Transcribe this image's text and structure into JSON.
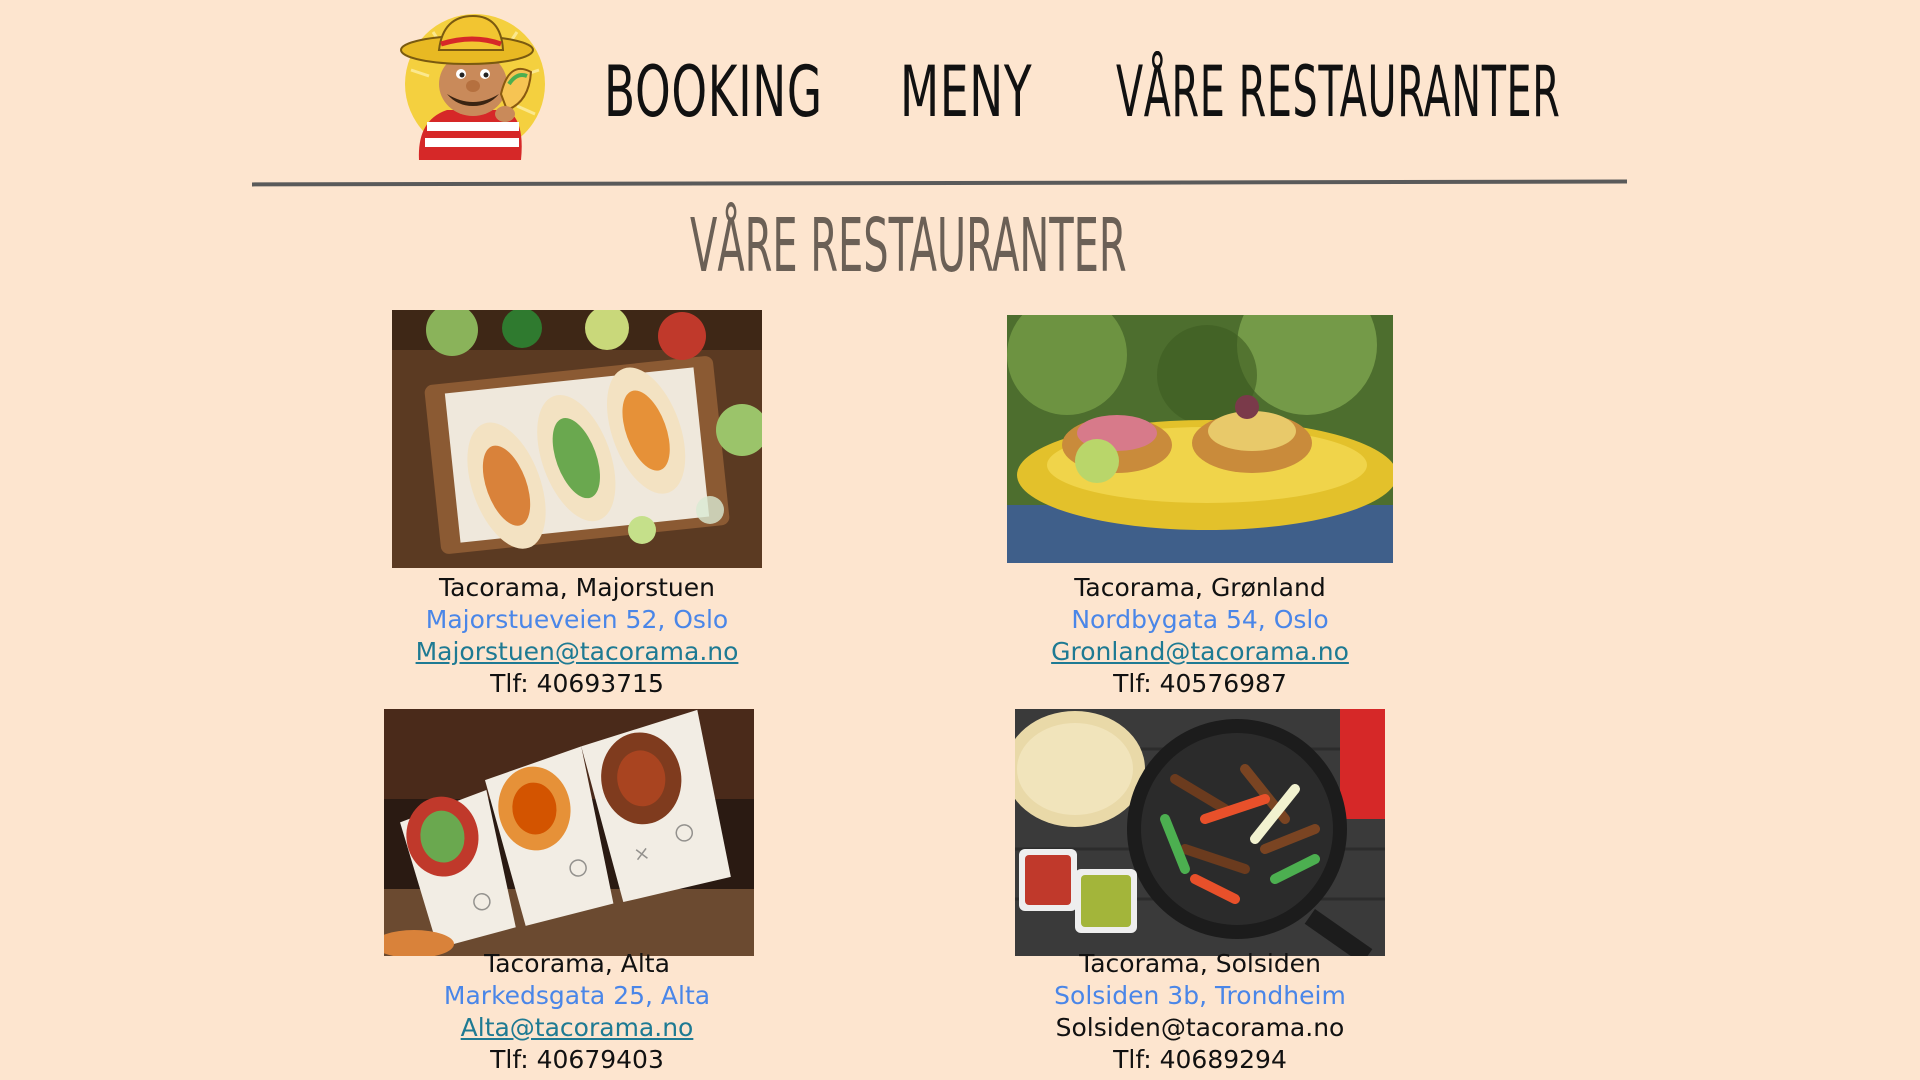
{
  "header": {
    "logo_icon": "taco-mascot-logo",
    "nav": {
      "booking": "BOOKING",
      "meny": "MENY",
      "restauranter": "VÅRE RESTAURANTER"
    }
  },
  "main": {
    "title": "VÅRE RESTAURANTER",
    "restaurants": [
      {
        "name": "Tacorama, Majorstuen",
        "address": "Majorstueveien 52, Oslo",
        "email": "Majorstuen@tacorama.no",
        "phone": "Tlf: 40693715",
        "photo_icon": "burritos-photo"
      },
      {
        "name": "Tacorama,  Grønland",
        "address": "Nordbygata 54, Oslo",
        "email": "Gronland@tacorama.no",
        "phone": "Tlf: 40576987",
        "photo_icon": "tostadas-photo"
      },
      {
        "name": "Tacorama, Alta",
        "address": "Markedsgata 25, Alta",
        "email": "Alta@tacorama.no",
        "phone": "Tlf: 40679403",
        "photo_icon": "wraps-photo"
      },
      {
        "name": "Tacorama, Solsiden",
        "address": "Solsiden 3b, Trondheim",
        "email": "Solsiden@tacorama.no",
        "phone": "Tlf: 40689294",
        "photo_icon": "fajita-skillet-photo"
      }
    ]
  },
  "colors": {
    "background": "#fde5cf",
    "link": "#1e7a93",
    "address": "#4a86e8",
    "title": "#6b6056"
  }
}
